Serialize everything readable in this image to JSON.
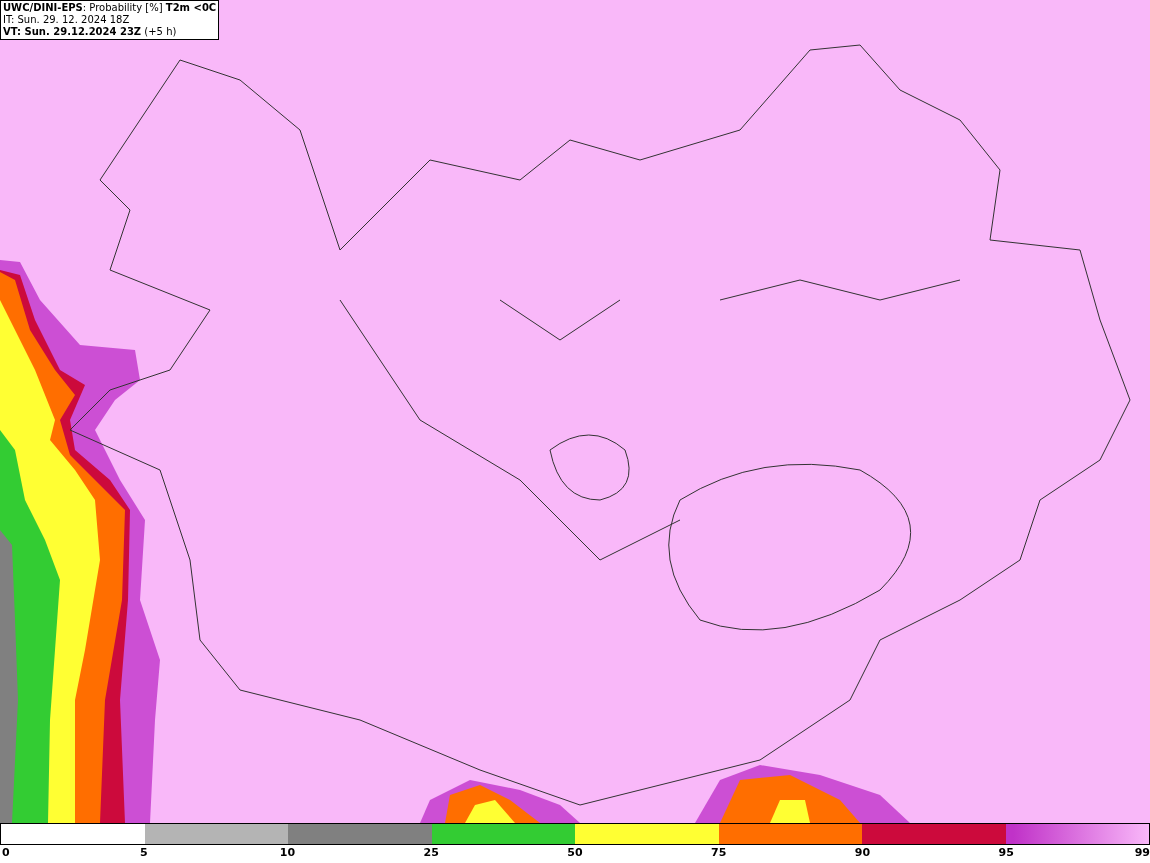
{
  "header": {
    "lines": [
      "**UWC/DINI-EPS**: Probability [%] **T2m <0C**",
      "IT: Sun. 29. 12. 2024 18Z",
      "**VT: Sun. 29.12.2024 23Z** (+5 h)"
    ]
  },
  "legend": {
    "segments": [
      {
        "color": "#ffffff"
      },
      {
        "color": "#b4b4b4"
      },
      {
        "color": "#808080"
      },
      {
        "color": "#33cc33"
      },
      {
        "color": "#ffff33"
      },
      {
        "color": "#ff6e00"
      },
      {
        "color": "#cc0a3c"
      },
      {
        "color": "#c032c8"
      }
    ],
    "labels": [
      "0",
      "5",
      "10",
      "25",
      "50",
      "75",
      "90",
      "95",
      "99"
    ]
  }
}
